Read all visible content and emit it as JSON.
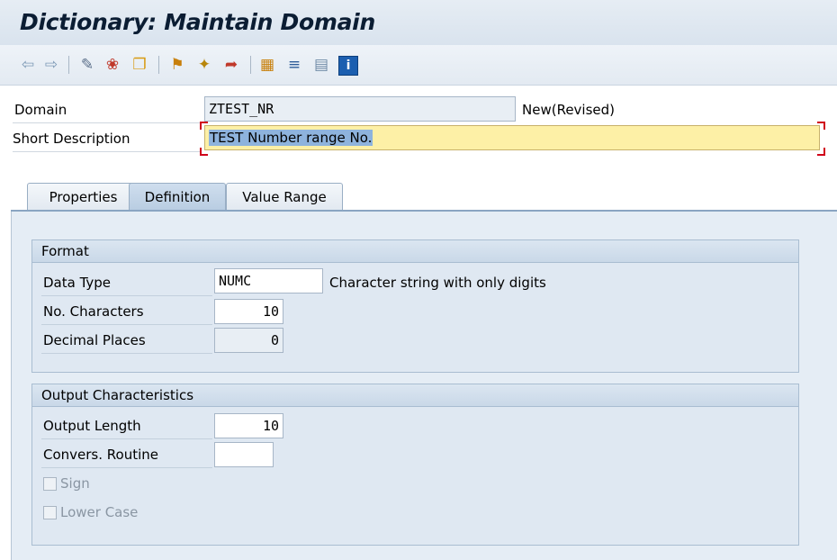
{
  "window": {
    "title": "Dictionary: Maintain Domain"
  },
  "toolbar": {
    "icons": [
      "back-arrow-icon",
      "forward-arrow-icon",
      "display-change-icon",
      "activate-icon",
      "other-object-icon",
      "where-used-icon",
      "magic-wand-icon",
      "transport-icon",
      "hierarchy-icon",
      "list-icon",
      "documentation-icon",
      "info-icon"
    ]
  },
  "header": {
    "domain_label": "Domain",
    "domain_value": "ZTEST_NR",
    "domain_status": "New(Revised)",
    "short_desc_label": "Short Description",
    "short_desc_value": "TEST Number range No."
  },
  "tabs": [
    {
      "label": "Properties",
      "active": false
    },
    {
      "label": "Definition",
      "active": true
    },
    {
      "label": "Value Range",
      "active": false
    }
  ],
  "format": {
    "title": "Format",
    "data_type_label": "Data Type",
    "data_type_value": "NUMC",
    "data_type_desc": "Character string with only digits",
    "no_chars_label": "No. Characters",
    "no_chars_value": "10",
    "decimals_label": "Decimal Places",
    "decimals_value": "0"
  },
  "output": {
    "title": "Output Characteristics",
    "length_label": "Output Length",
    "length_value": "10",
    "conv_label": "Convers. Routine",
    "conv_value": "",
    "sign_label": "Sign",
    "lower_label": "Lower Case"
  },
  "colors": {
    "required_field": "#fdf0a6",
    "tab_active": "#c4d6e8",
    "panel_bg": "#e5edf5"
  }
}
